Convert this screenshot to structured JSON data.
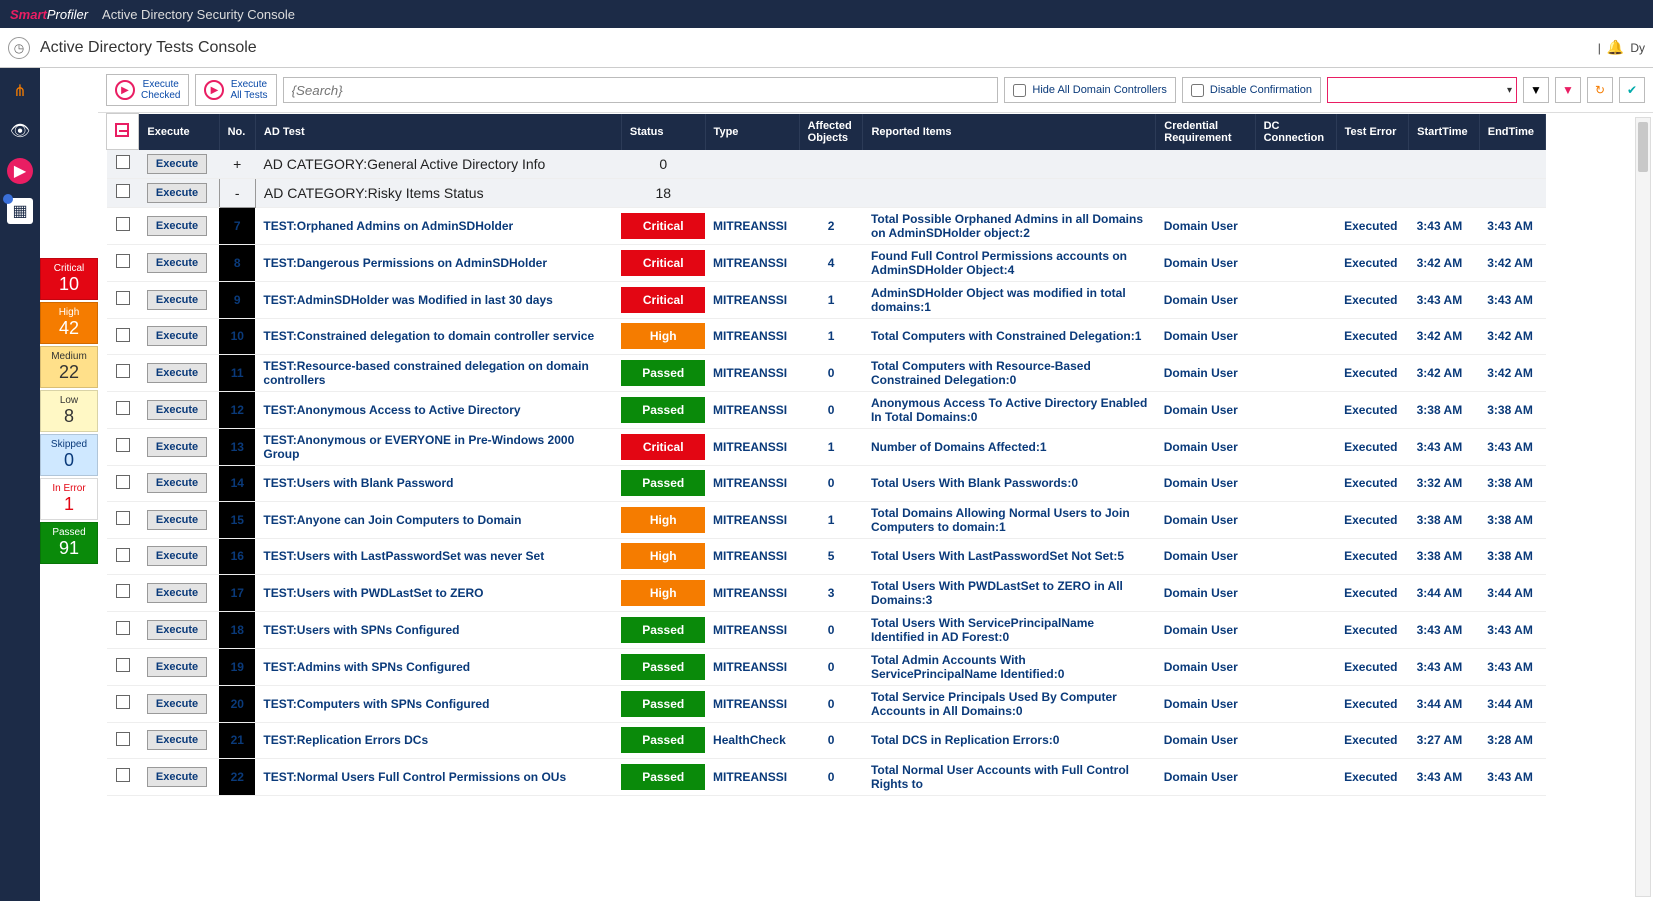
{
  "brand": {
    "part1": "Smart",
    "part2": "Profiler"
  },
  "app_title": "Active Directory Security Console",
  "page_title": "Active Directory Tests Console",
  "right_label": "Dy",
  "toolbar": {
    "execute_checked": "Execute\nChecked",
    "execute_all": "Execute\nAll Tests",
    "search_placeholder": "{Search}",
    "hide_dc": "Hide All Domain Controllers",
    "disable_confirm": "Disable Confirmation"
  },
  "stats": [
    {
      "label": "Critical",
      "value": "10",
      "cls": "s-critical"
    },
    {
      "label": "High",
      "value": "42",
      "cls": "s-high"
    },
    {
      "label": "Medium",
      "value": "22",
      "cls": "s-medium"
    },
    {
      "label": "Low",
      "value": "8",
      "cls": "s-low"
    },
    {
      "label": "Skipped",
      "value": "0",
      "cls": "s-skipped"
    },
    {
      "label": "In Error",
      "value": "1",
      "cls": "s-error"
    },
    {
      "label": "Passed",
      "value": "91",
      "cls": "s-passed"
    }
  ],
  "columns": [
    "",
    "Execute",
    "No.",
    "AD Test",
    "Status",
    "Type",
    "Affected Objects",
    "Reported Items",
    "Credential Requirement",
    "DC Connection",
    "Test Error",
    "StartTime",
    "EndTime"
  ],
  "categories": [
    {
      "name": "AD CATEGORY:General Active Directory Info",
      "count": "0",
      "countcls": "catnum0",
      "sign": "+",
      "signcls": "plus"
    },
    {
      "name": "AD CATEGORY:Risky Items Status",
      "count": "18",
      "countcls": "catnum",
      "sign": "-",
      "signcls": "minus"
    }
  ],
  "execute_label": "Execute",
  "rows": [
    {
      "no": "7",
      "test": "TEST:Orphaned Admins on AdminSDHolder",
      "status": "Critical",
      "stcls": "st-critical",
      "type": "MITREANSSI",
      "obj": "2",
      "objcls": "c-red",
      "rep": "Total Possible Orphaned Admins in all Domains on AdminSDHolder object:2",
      "cred": "Domain User",
      "err": "Executed",
      "start": "3:43 AM",
      "end": "3:43 AM"
    },
    {
      "no": "8",
      "test": "TEST:Dangerous Permissions on AdminSDHolder",
      "status": "Critical",
      "stcls": "st-critical",
      "type": "MITREANSSI",
      "obj": "4",
      "objcls": "c-red",
      "rep": "Found Full Control Permissions accounts on AdminSDHolder Object:4",
      "cred": "Domain User",
      "err": "Executed",
      "start": "3:42 AM",
      "end": "3:42 AM"
    },
    {
      "no": "9",
      "test": "TEST:AdminSDHolder was Modified in last 30 days",
      "status": "Critical",
      "stcls": "st-critical",
      "type": "MITREANSSI",
      "obj": "1",
      "objcls": "c-red",
      "rep": "AdminSDHolder Object was modified in total domains:1",
      "cred": "Domain User",
      "err": "Executed",
      "start": "3:43 AM",
      "end": "3:43 AM"
    },
    {
      "no": "10",
      "test": "TEST:Constrained delegation to domain controller service",
      "status": "High",
      "stcls": "st-high",
      "type": "MITREANSSI",
      "obj": "1",
      "objcls": "c-red",
      "rep": "Total Computers with Constrained Delegation:1",
      "cred": "Domain User",
      "err": "Executed",
      "start": "3:42 AM",
      "end": "3:42 AM"
    },
    {
      "no": "11",
      "test": "TEST:Resource-based constrained delegation on domain controllers",
      "status": "Passed",
      "stcls": "st-passed",
      "type": "MITREANSSI",
      "obj": "0",
      "objcls": "c-green",
      "rep": "Total Computers with Resource-Based Constrained Delegation:0",
      "cred": "Domain User",
      "err": "Executed",
      "start": "3:42 AM",
      "end": "3:42 AM"
    },
    {
      "no": "12",
      "test": "TEST:Anonymous Access to Active Directory",
      "status": "Passed",
      "stcls": "st-passed",
      "type": "MITREANSSI",
      "obj": "0",
      "objcls": "c-green",
      "rep": "Anonymous Access To Active Directory Enabled In Total Domains:0",
      "cred": "Domain User",
      "err": "Executed",
      "start": "3:38 AM",
      "end": "3:38 AM"
    },
    {
      "no": "13",
      "test": "TEST:Anonymous or EVERYONE in Pre-Windows 2000 Group",
      "status": "Critical",
      "stcls": "st-critical",
      "type": "MITREANSSI",
      "obj": "1",
      "objcls": "c-red",
      "rep": "Number of Domains Affected:1",
      "cred": "Domain User",
      "err": "Executed",
      "start": "3:43 AM",
      "end": "3:43 AM"
    },
    {
      "no": "14",
      "test": "TEST:Users with Blank Password",
      "status": "Passed",
      "stcls": "st-passed",
      "type": "MITREANSSI",
      "obj": "0",
      "objcls": "c-green",
      "rep": "Total Users With Blank Passwords:0",
      "cred": "Domain User",
      "err": "Executed",
      "start": "3:32 AM",
      "end": "3:38 AM"
    },
    {
      "no": "15",
      "test": "TEST:Anyone can Join Computers to Domain",
      "status": "High",
      "stcls": "st-high",
      "type": "MITREANSSI",
      "obj": "1",
      "objcls": "c-red",
      "rep": "Total Domains Allowing Normal Users to Join Computers to domain:1",
      "cred": "Domain User",
      "err": "Executed",
      "start": "3:38 AM",
      "end": "3:38 AM"
    },
    {
      "no": "16",
      "test": "TEST:Users with LastPasswordSet was never Set",
      "status": "High",
      "stcls": "st-high",
      "type": "MITREANSSI",
      "obj": "5",
      "objcls": "c-red",
      "rep": "Total Users With LastPasswordSet Not Set:5",
      "cred": "Domain User",
      "err": "Executed",
      "start": "3:38 AM",
      "end": "3:38 AM"
    },
    {
      "no": "17",
      "test": "TEST:Users with PWDLastSet to ZERO",
      "status": "High",
      "stcls": "st-high",
      "type": "MITREANSSI",
      "obj": "3",
      "objcls": "c-red",
      "rep": "Total Users With PWDLastSet to ZERO in All Domains:3",
      "cred": "Domain User",
      "err": "Executed",
      "start": "3:44 AM",
      "end": "3:44 AM"
    },
    {
      "no": "18",
      "test": "TEST:Users with SPNs Configured",
      "status": "Passed",
      "stcls": "st-passed",
      "type": "MITREANSSI",
      "obj": "0",
      "objcls": "c-green",
      "rep": "Total Users With ServicePrincipalName Identified in AD Forest:0",
      "cred": "Domain User",
      "err": "Executed",
      "start": "3:43 AM",
      "end": "3:43 AM"
    },
    {
      "no": "19",
      "test": "TEST:Admins with SPNs Configured",
      "status": "Passed",
      "stcls": "st-passed",
      "type": "MITREANSSI",
      "obj": "0",
      "objcls": "c-green",
      "rep": "Total Admin Accounts With ServicePrincipalName Identified:0",
      "cred": "Domain User",
      "err": "Executed",
      "start": "3:43 AM",
      "end": "3:43 AM"
    },
    {
      "no": "20",
      "test": "TEST:Computers with SPNs Configured",
      "status": "Passed",
      "stcls": "st-passed",
      "type": "MITREANSSI",
      "obj": "0",
      "objcls": "c-green",
      "rep": "Total Service Principals Used By Computer Accounts in All Domains:0",
      "cred": "Domain User",
      "err": "Executed",
      "start": "3:44 AM",
      "end": "3:44 AM"
    },
    {
      "no": "21",
      "test": "TEST:Replication Errors DCs",
      "status": "Passed",
      "stcls": "st-passed",
      "type": "HealthCheck",
      "obj": "0",
      "objcls": "c-green",
      "rep": "Total DCS in Replication Errors:0",
      "cred": "Domain User",
      "err": "Executed",
      "start": "3:27 AM",
      "end": "3:28 AM"
    },
    {
      "no": "22",
      "test": "TEST:Normal Users Full Control Permissions on OUs",
      "status": "Passed",
      "stcls": "st-passed",
      "type": "MITREANSSI",
      "obj": "0",
      "objcls": "c-green",
      "rep": "Total Normal User Accounts with Full Control Rights to",
      "cred": "Domain User",
      "err": "Executed",
      "start": "3:43 AM",
      "end": "3:43 AM"
    }
  ]
}
